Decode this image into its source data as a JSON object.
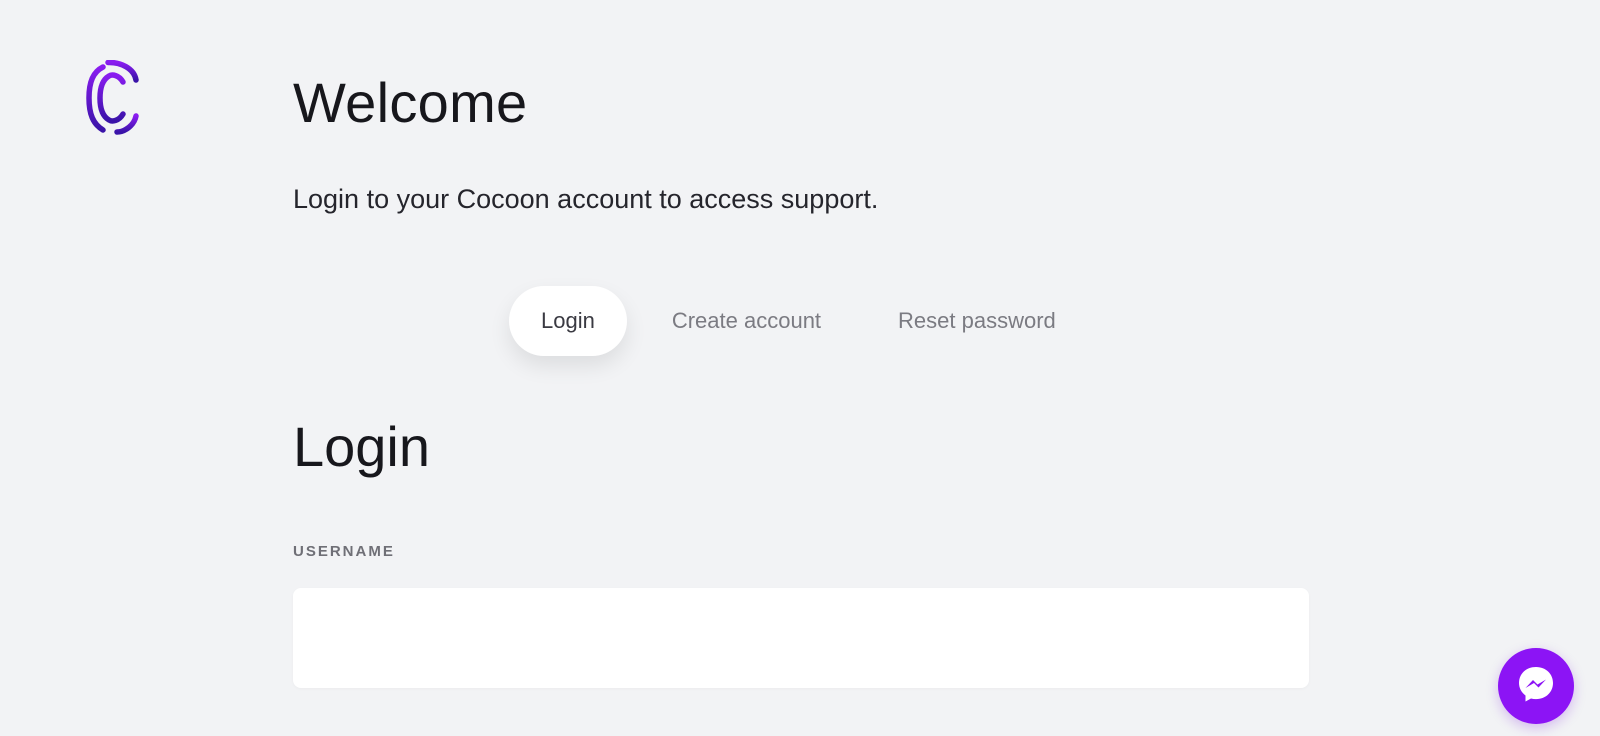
{
  "welcome": {
    "title": "Welcome",
    "subtitle": "Login to your Cocoon account to access support."
  },
  "tabs": [
    {
      "label": "Login",
      "active": true
    },
    {
      "label": "Create account",
      "active": false
    },
    {
      "label": "Reset password",
      "active": false
    }
  ],
  "login_form": {
    "heading": "Login",
    "username_label": "USERNAME",
    "username_value": "",
    "username_placeholder": ""
  },
  "icons": {
    "logo": "cocoon-logo-icon",
    "chat": "messenger-icon"
  },
  "colors": {
    "background": "#f2f3f5",
    "brand_purple": "#8c14f5",
    "brand_purple_dark": "#3a13a8"
  }
}
